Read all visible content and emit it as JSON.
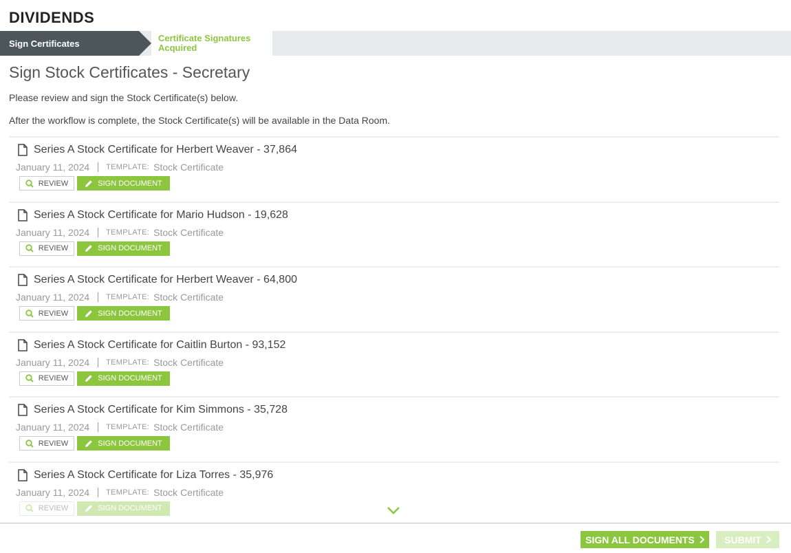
{
  "app": {
    "title": "DIVIDENDS"
  },
  "stepper": {
    "active_step": "Sign Certificates",
    "next_step_line1": "Certificate Signatures",
    "next_step_line2": "Acquired"
  },
  "page": {
    "title": "Sign Stock Certificates - Secretary",
    "intro1": "Please review and sign the Stock Certificate(s) below.",
    "intro2": "After the workflow is complete, the Stock Certificate(s) will be available in the Data Room."
  },
  "labels": {
    "template_label": "TEMPLATE:",
    "review": "REVIEW",
    "sign_document": "SIGN DOCUMENT"
  },
  "documents": [
    {
      "title": "Series A Stock Certificate for Herbert Weaver - 37,864",
      "date": "January 11, 2024",
      "template": "Stock Certificate"
    },
    {
      "title": "Series A Stock Certificate for Mario Hudson - 19,628",
      "date": "January 11, 2024",
      "template": "Stock Certificate"
    },
    {
      "title": "Series A Stock Certificate for Herbert Weaver - 64,800",
      "date": "January 11, 2024",
      "template": "Stock Certificate"
    },
    {
      "title": "Series A Stock Certificate for Caitlin Burton - 93,152",
      "date": "January 11, 2024",
      "template": "Stock Certificate"
    },
    {
      "title": "Series A Stock Certificate for Kim Simmons - 35,728",
      "date": "January 11, 2024",
      "template": "Stock Certificate"
    },
    {
      "title": "Series A Stock Certificate for Liza Torres - 35,976",
      "date": "January 11, 2024",
      "template": "Stock Certificate"
    }
  ],
  "footer": {
    "sign_all": "SIGN ALL DOCUMENTS",
    "submit": "SUBMIT"
  },
  "colors": {
    "accent": "#8cc63f",
    "stepper_active": "#4d565b"
  }
}
